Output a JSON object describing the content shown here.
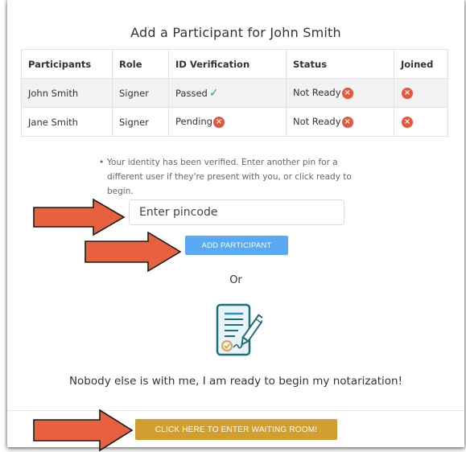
{
  "title": "Add a Participant for John Smith",
  "table": {
    "headers": [
      "Participants",
      "Role",
      "ID Verification",
      "Status",
      "Joined"
    ],
    "rows": [
      {
        "name": "John Smith",
        "role": "Signer",
        "id_verification": "Passed",
        "status": "Not Ready"
      },
      {
        "name": "Jane Smith",
        "role": "Signer",
        "id_verification": "Pending",
        "status": "Not Ready"
      }
    ]
  },
  "info_text": "Your identity has been verified. Enter another pin for a different user if they're present with you, or click ready to begin.",
  "pin_input": {
    "placeholder": "Enter pincode",
    "value": ""
  },
  "add_button": "ADD PARTICIPANT",
  "or_text": "Or",
  "ready_text": "Nobody else is with me, I am ready to begin my notarization!",
  "waiting_button": "CLICK HERE TO ENTER WAITING ROOM!",
  "icons": {
    "passed": "check-icon",
    "pending": "x-circle-icon",
    "not_ready": "x-circle-icon",
    "not_joined": "x-circle-icon",
    "document": "document-signature-icon",
    "annotation": "arrow-icon"
  },
  "colors": {
    "add_button": "#59aaf2",
    "waiting_button": "#d39e30",
    "error_icon": "#e8563b",
    "check": "#1ea58c",
    "arrow_fill": "#e8613f",
    "icon_teal": "#1d6f7d"
  }
}
